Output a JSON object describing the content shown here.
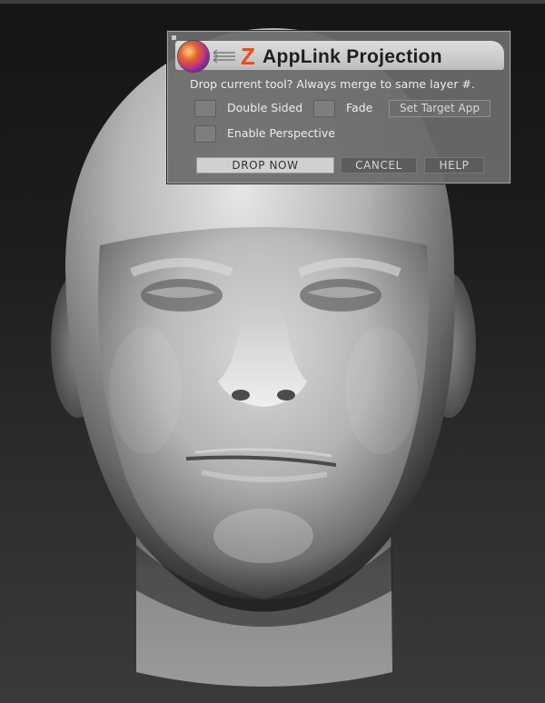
{
  "dialog": {
    "title_z": "Z",
    "title": "AppLink Projection",
    "message": "Drop current tool? Always merge to same layer #.",
    "options": {
      "double_sided": "Double Sided",
      "fade": "Fade",
      "enable_perspective": "Enable Perspective"
    },
    "set_target_app": "Set Target App",
    "buttons": {
      "drop_now": "DROP NOW",
      "cancel": "CANCEL",
      "help": "HELP"
    }
  },
  "icons": [
    "zbrush-logo-icon",
    "applink-arrows-icon"
  ],
  "colors": {
    "z_accent": "#ee4a1a",
    "dialog_bg": "#6c6c6c",
    "titlebar": "#cfcfcf"
  }
}
